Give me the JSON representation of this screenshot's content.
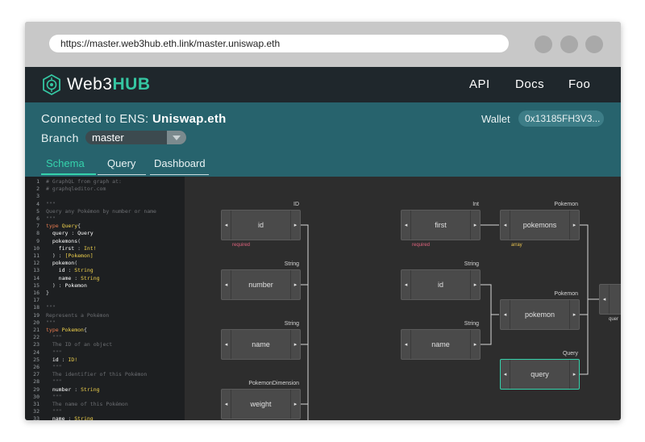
{
  "browser": {
    "url": "https://master.web3hub.eth.link/master.uniswap.eth"
  },
  "nav": {
    "logo_prefix": "Web3",
    "logo_suffix": "HUB",
    "links": [
      "API",
      "Docs",
      "Foo"
    ]
  },
  "header": {
    "connected_prefix": "Connected to ENS:",
    "ens_name": "Uniswap.eth",
    "wallet_label": "Wallet",
    "wallet_address": "0x13185FH3V3...",
    "branch_label": "Branch",
    "branch_value": "master",
    "tabs": [
      "Schema",
      "Query",
      "Dashboard"
    ],
    "active_tab": "Schema"
  },
  "editor": {
    "lines": [
      [
        [
          "c-cm",
          "# GraphQL from graph at:"
        ]
      ],
      [
        [
          "c-cm",
          "# graphqleditor.com"
        ]
      ],
      [],
      [
        [
          "c-cm",
          "\"\"\""
        ]
      ],
      [
        [
          "c-cm",
          "Query any Pokémon by number or name"
        ]
      ],
      [
        [
          "c-cm",
          "\"\"\""
        ]
      ],
      [
        [
          "c-kw",
          "type "
        ],
        [
          "c-ty",
          "Query"
        ],
        [
          "c-pu",
          "{"
        ]
      ],
      [
        [
          "c-id",
          "  query "
        ],
        [
          "c-pu",
          ": "
        ],
        [
          "c-fn",
          "Query"
        ]
      ],
      [
        [
          "c-id",
          "  pokemons"
        ],
        [
          "c-pu",
          "("
        ]
      ],
      [
        [
          "c-id",
          "    first "
        ],
        [
          "c-pu",
          ": "
        ],
        [
          "c-ty",
          "Int!"
        ]
      ],
      [
        [
          "c-pu",
          "  ) : "
        ],
        [
          "c-ty",
          "[Pokemon]"
        ]
      ],
      [
        [
          "c-id",
          "  pokemon"
        ],
        [
          "c-pu",
          "("
        ]
      ],
      [
        [
          "c-id",
          "    id "
        ],
        [
          "c-pu",
          ": "
        ],
        [
          "c-ty",
          "String"
        ]
      ],
      [
        [
          "c-id",
          "    name "
        ],
        [
          "c-pu",
          ": "
        ],
        [
          "c-ty",
          "String"
        ]
      ],
      [
        [
          "c-pu",
          "  ) : "
        ],
        [
          "c-fn",
          "Pokemon"
        ]
      ],
      [
        [
          "c-pu",
          "}"
        ]
      ],
      [],
      [
        [
          "c-cm",
          "\"\"\""
        ]
      ],
      [
        [
          "c-cm",
          "Represents a Pokémon"
        ]
      ],
      [
        [
          "c-cm",
          "\"\"\""
        ]
      ],
      [
        [
          "c-kw",
          "type "
        ],
        [
          "c-ty",
          "Pokemon"
        ],
        [
          "c-pu",
          "{"
        ]
      ],
      [
        [
          "c-cm",
          "  \"\"\""
        ]
      ],
      [
        [
          "c-cm",
          "  The ID of an object"
        ]
      ],
      [
        [
          "c-cm",
          "  \"\"\""
        ]
      ],
      [
        [
          "c-id",
          "  id "
        ],
        [
          "c-pu",
          ": "
        ],
        [
          "c-ty",
          "ID!"
        ]
      ],
      [
        [
          "c-cm",
          "  \"\"\""
        ]
      ],
      [
        [
          "c-cm",
          "  The identifier of this Pokémon"
        ]
      ],
      [
        [
          "c-cm",
          "  \"\"\""
        ]
      ],
      [
        [
          "c-id",
          "  number "
        ],
        [
          "c-pu",
          ": "
        ],
        [
          "c-ty",
          "String"
        ]
      ],
      [
        [
          "c-cm",
          "  \"\"\""
        ]
      ],
      [
        [
          "c-cm",
          "  The name of this Pokémon"
        ]
      ],
      [
        [
          "c-cm",
          "  \"\"\""
        ]
      ],
      [
        [
          "c-id",
          "  name "
        ],
        [
          "c-pu",
          ": "
        ],
        [
          "c-ty",
          "String"
        ]
      ]
    ]
  },
  "graph": {
    "nodes": [
      {
        "label": "id",
        "type": "ID",
        "note": "required",
        "note_kind": "req"
      },
      {
        "label": "number",
        "type": "String",
        "note": "",
        "note_kind": ""
      },
      {
        "label": "name",
        "type": "String",
        "note": "",
        "note_kind": ""
      },
      {
        "label": "weight",
        "type": "PokemonDimension",
        "note": "",
        "note_kind": ""
      },
      {
        "label": "first",
        "type": "Int",
        "note": "required",
        "note_kind": "req"
      },
      {
        "label": "id",
        "type": "String",
        "note": "",
        "note_kind": ""
      },
      {
        "label": "name",
        "type": "String",
        "note": "",
        "note_kind": ""
      },
      {
        "label": "pokemons",
        "type": "Pokemon",
        "note": "array",
        "note_kind": "arr"
      },
      {
        "label": "pokemon",
        "type": "Pokemon",
        "note": "",
        "note_kind": ""
      },
      {
        "label": "query",
        "type": "Query",
        "note": "",
        "note_kind": "",
        "selected": true
      }
    ],
    "offscreen_label": "quer",
    "arrow_left": "◂",
    "arrow_right": "▸"
  },
  "colors": {
    "accent": "#35d3ac",
    "header_bg": "#27636d",
    "nav_bg": "#1f272c"
  }
}
